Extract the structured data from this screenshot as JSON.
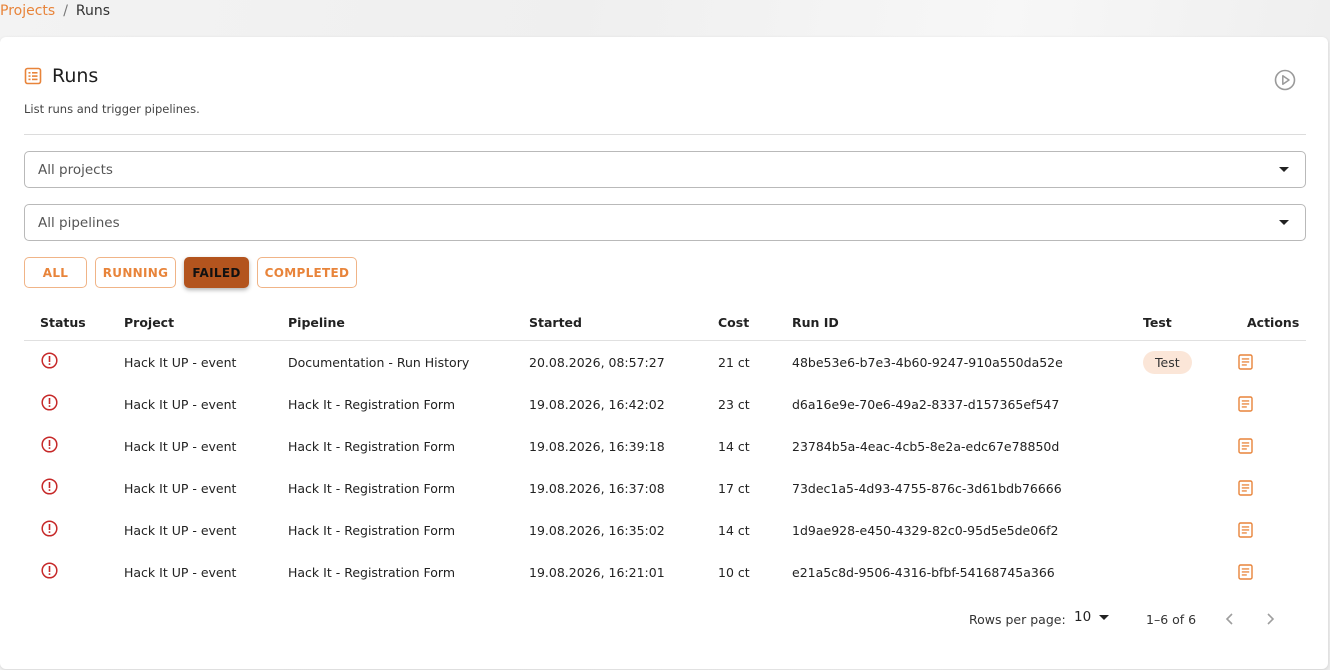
{
  "breadcrumb": {
    "parent": "Projects",
    "separator": "/",
    "current": "Runs"
  },
  "header": {
    "title": "Runs",
    "subtitle": "List runs and trigger pipelines.",
    "icon": "list-icon",
    "trigger_icon": "play-circle-icon"
  },
  "filters": {
    "project_select": {
      "value": "All projects"
    },
    "pipeline_select": {
      "value": "All pipelines"
    },
    "status_chips": [
      {
        "label": "ALL",
        "selected": false
      },
      {
        "label": "RUNNING",
        "selected": false
      },
      {
        "label": "FAILED",
        "selected": true
      },
      {
        "label": "COMPLETED",
        "selected": false
      }
    ]
  },
  "table": {
    "columns": [
      "Status",
      "Project",
      "Pipeline",
      "Started",
      "Cost",
      "Run ID",
      "Test",
      "Actions"
    ],
    "rows": [
      {
        "status": "failed",
        "project": "Hack It UP - event",
        "pipeline": "Documentation - Run History",
        "started": "20.08.2026, 08:57:27",
        "cost": "21 ct",
        "run_id": "48be53e6-b7e3-4b60-9247-910a550da52e",
        "test": "Test"
      },
      {
        "status": "failed",
        "project": "Hack It UP - event",
        "pipeline": "Hack It - Registration Form",
        "started": "19.08.2026, 16:42:02",
        "cost": "23 ct",
        "run_id": "d6a16e9e-70e6-49a2-8337-d157365ef547",
        "test": ""
      },
      {
        "status": "failed",
        "project": "Hack It UP - event",
        "pipeline": "Hack It - Registration Form",
        "started": "19.08.2026, 16:39:18",
        "cost": "14 ct",
        "run_id": "23784b5a-4eac-4cb5-8e2a-edc67e78850d",
        "test": ""
      },
      {
        "status": "failed",
        "project": "Hack It UP - event",
        "pipeline": "Hack It - Registration Form",
        "started": "19.08.2026, 16:37:08",
        "cost": "17 ct",
        "run_id": "73dec1a5-4d93-4755-876c-3d61bdb76666",
        "test": ""
      },
      {
        "status": "failed",
        "project": "Hack It UP - event",
        "pipeline": "Hack It - Registration Form",
        "started": "19.08.2026, 16:35:02",
        "cost": "14 ct",
        "run_id": "1d9ae928-e450-4329-82c0-95d5e5de06f2",
        "test": ""
      },
      {
        "status": "failed",
        "project": "Hack It UP - event",
        "pipeline": "Hack It - Registration Form",
        "started": "19.08.2026, 16:21:01",
        "cost": "10 ct",
        "run_id": "e21a5c8d-9506-4316-bfbf-54168745a366",
        "test": ""
      }
    ]
  },
  "pagination": {
    "rows_per_page_label": "Rows per page:",
    "rows_per_page": "10",
    "range": "1–6 of 6"
  },
  "colors": {
    "accent": "#e8843a",
    "selected_chip": "#b3541e",
    "failed_status": "#c62828",
    "test_badge_bg": "#fbe6d8"
  }
}
